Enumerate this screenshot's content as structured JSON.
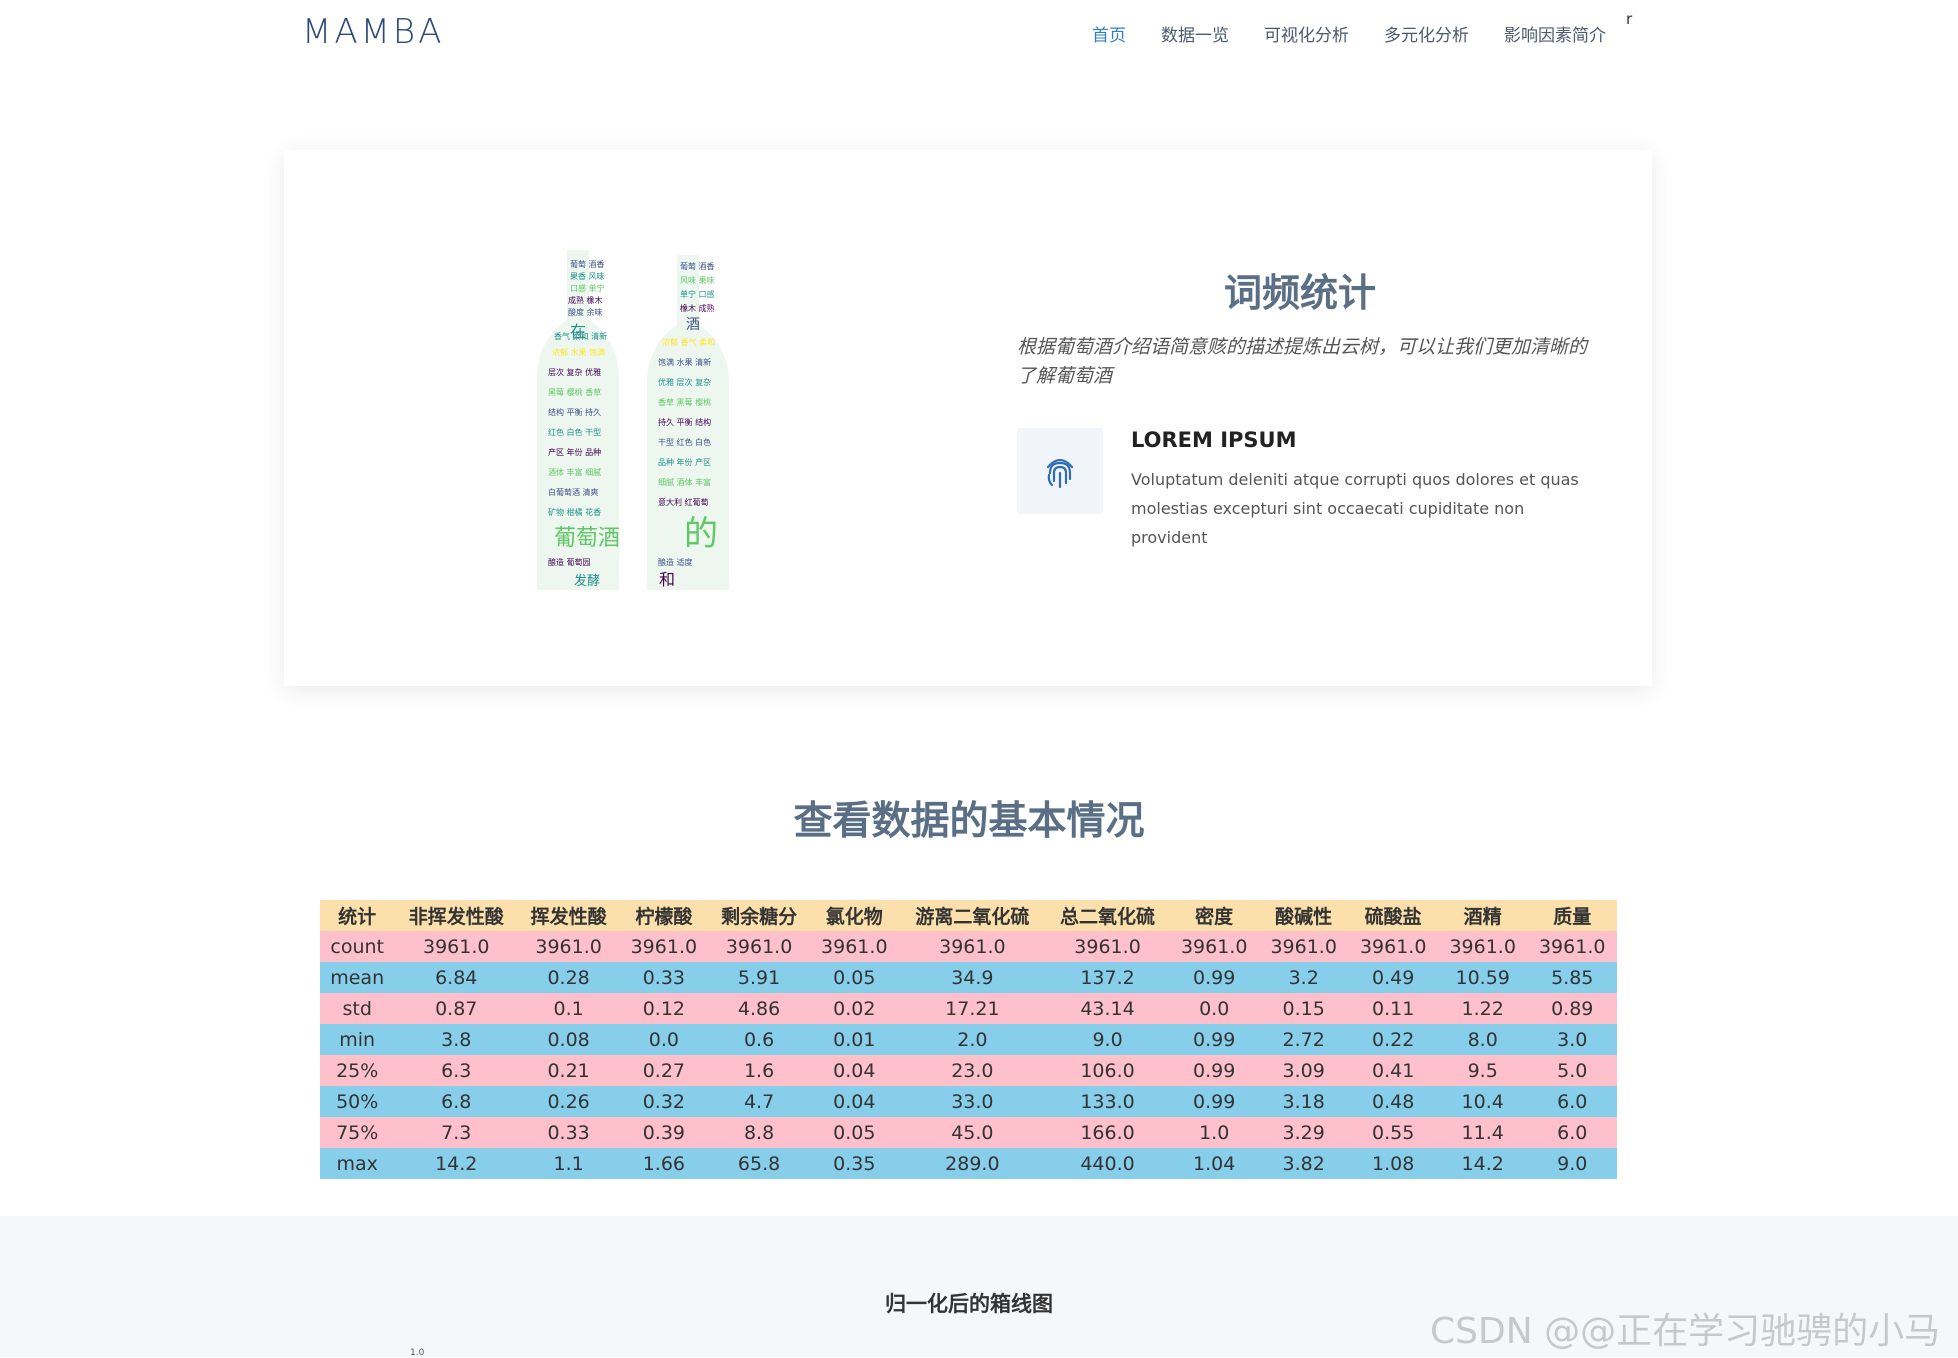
{
  "header": {
    "logo": "MAMBA",
    "nav": [
      "首页",
      "数据一览",
      "可视化分析",
      "多元化分析",
      "影响因素简介"
    ],
    "extra": "r"
  },
  "intro": {
    "title": "词频统计",
    "description": "根据葡萄酒介绍语简意赅的描述提炼出云树，可以让我们更加清晰的了解葡萄酒",
    "feature": {
      "icon": "fingerprint-icon",
      "title": "LOREM IPSUM",
      "text": "Voluptatum deleniti atque corrupti quos dolores et quas molestias excepturi sint occaecati cupiditate non provident"
    },
    "wordcloud_words": [
      "葡萄酒",
      "的",
      "在",
      "和",
      "发酵",
      "酒"
    ]
  },
  "stats": {
    "title": "查看数据的基本情况",
    "headers": [
      "统计",
      "非挥发性酸",
      "挥发性酸",
      "柠檬酸",
      "剩余糖分",
      "氯化物",
      "游离二氧化硫",
      "总二氧化硫",
      "密度",
      "酸碱性",
      "硫酸盐",
      "酒精",
      "质量"
    ],
    "rows": [
      [
        "count",
        "3961.0",
        "3961.0",
        "3961.0",
        "3961.0",
        "3961.0",
        "3961.0",
        "3961.0",
        "3961.0",
        "3961.0",
        "3961.0",
        "3961.0",
        "3961.0"
      ],
      [
        "mean",
        "6.84",
        "0.28",
        "0.33",
        "5.91",
        "0.05",
        "34.9",
        "137.2",
        "0.99",
        "3.2",
        "0.49",
        "10.59",
        "5.85"
      ],
      [
        "std",
        "0.87",
        "0.1",
        "0.12",
        "4.86",
        "0.02",
        "17.21",
        "43.14",
        "0.0",
        "0.15",
        "0.11",
        "1.22",
        "0.89"
      ],
      [
        "min",
        "3.8",
        "0.08",
        "0.0",
        "0.6",
        "0.01",
        "2.0",
        "9.0",
        "0.99",
        "2.72",
        "0.22",
        "8.0",
        "3.0"
      ],
      [
        "25%",
        "6.3",
        "0.21",
        "0.27",
        "1.6",
        "0.04",
        "23.0",
        "106.0",
        "0.99",
        "3.09",
        "0.41",
        "9.5",
        "5.0"
      ],
      [
        "50%",
        "6.8",
        "0.26",
        "0.32",
        "4.7",
        "0.04",
        "33.0",
        "133.0",
        "0.99",
        "3.18",
        "0.48",
        "10.4",
        "6.0"
      ],
      [
        "75%",
        "7.3",
        "0.33",
        "0.39",
        "8.8",
        "0.05",
        "45.0",
        "166.0",
        "1.0",
        "3.29",
        "0.55",
        "11.4",
        "6.0"
      ],
      [
        "max",
        "14.2",
        "1.1",
        "1.66",
        "65.8",
        "0.35",
        "289.0",
        "440.0",
        "1.04",
        "3.82",
        "1.08",
        "14.2",
        "9.0"
      ]
    ],
    "colors": {
      "header": "#fce0ac",
      "pink": "#fec0cb",
      "blue": "#87ceeb"
    }
  },
  "boxplot": {
    "title": "归一化后的箱线图",
    "top_tick": "1.0"
  },
  "watermark": "CSDN @@正在学习驰骋的小马"
}
